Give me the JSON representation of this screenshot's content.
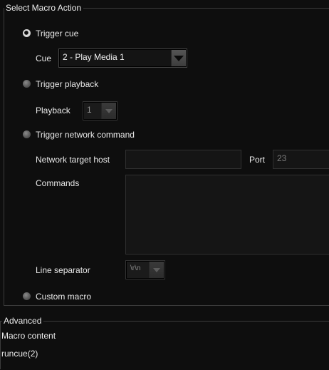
{
  "macro_action": {
    "title": "Select Macro Action",
    "options": {
      "trigger_cue": "Trigger cue",
      "trigger_playback": "Trigger playback",
      "trigger_network": "Trigger network command",
      "custom_macro": "Custom macro"
    },
    "selected_option": "trigger_cue",
    "cue": {
      "label": "Cue",
      "value": "2 - Play Media 1"
    },
    "playback": {
      "label": "Playback",
      "value": "1"
    },
    "network": {
      "host_label": "Network target host",
      "host_value": "",
      "port_label": "Port",
      "port_value": "23",
      "commands_label": "Commands",
      "commands_value": "",
      "line_separator_label": "Line separator",
      "line_separator_value": "\\r\\n"
    }
  },
  "advanced": {
    "title": "Advanced",
    "macro_content_label": "Macro content",
    "macro_content_value": "runcue(2)"
  }
}
